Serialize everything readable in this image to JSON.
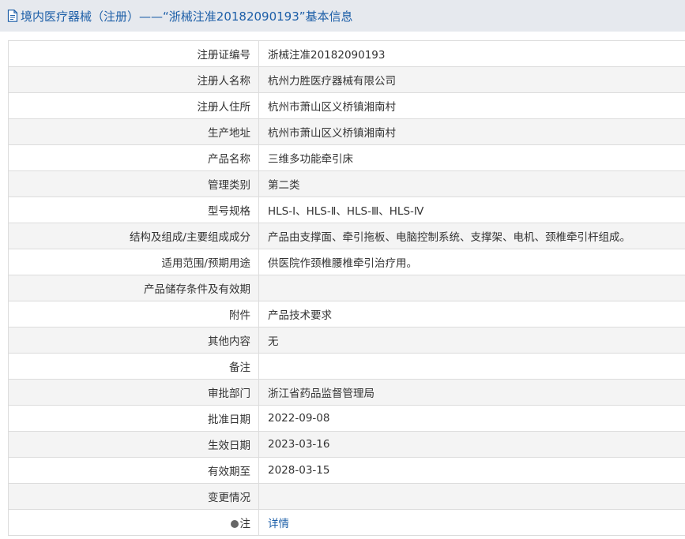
{
  "header": {
    "title": "境内医疗器械（注册）——“浙械注准20182090193”基本信息"
  },
  "rows": [
    {
      "label": "注册证编号",
      "value": "浙械注准20182090193"
    },
    {
      "label": "注册人名称",
      "value": "杭州力胜医疗器械有限公司"
    },
    {
      "label": "注册人住所",
      "value": "杭州市萧山区义桥镇湘南村"
    },
    {
      "label": "生产地址",
      "value": "杭州市萧山区义桥镇湘南村"
    },
    {
      "label": "产品名称",
      "value": "三维多功能牵引床"
    },
    {
      "label": "管理类别",
      "value": "第二类"
    },
    {
      "label": "型号规格",
      "value": "HLS-Ⅰ、HLS-Ⅱ、HLS-Ⅲ、HLS-Ⅳ"
    },
    {
      "label": "结构及组成/主要组成成分",
      "value": "产品由支撑面、牵引拖板、电脑控制系统、支撑架、电机、颈椎牵引杆组成。"
    },
    {
      "label": "适用范围/预期用途",
      "value": "供医院作颈椎腰椎牵引治疗用。"
    },
    {
      "label": "产品储存条件及有效期",
      "value": ""
    },
    {
      "label": "附件",
      "value": "产品技术要求"
    },
    {
      "label": "其他内容",
      "value": "无"
    },
    {
      "label": "备注",
      "value": ""
    },
    {
      "label": "审批部门",
      "value": "浙江省药品监督管理局"
    },
    {
      "label": "批准日期",
      "value": "2022-09-08"
    },
    {
      "label": "生效日期",
      "value": "2023-03-16"
    },
    {
      "label": "有效期至",
      "value": "2028-03-15"
    },
    {
      "label": "变更情况",
      "value": ""
    },
    {
      "label": "注",
      "value": "详情"
    }
  ]
}
